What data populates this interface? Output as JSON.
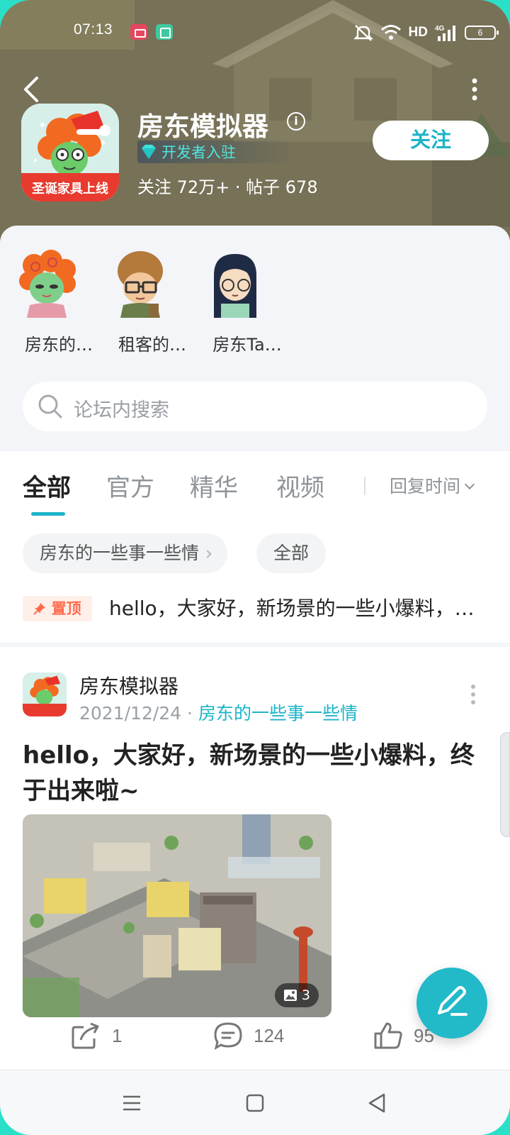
{
  "status_bar": {
    "time": "07:13",
    "network": "HD",
    "signal": "4G",
    "battery": "6"
  },
  "header": {
    "app_name": "房东模拟器",
    "developer_badge": "开发者入驻",
    "stats": "关注 72万+ · 帖子 678",
    "follow_label": "关注",
    "icon_banner_text": "圣诞家具上线"
  },
  "characters": [
    {
      "label": "房东的…"
    },
    {
      "label": "租客的…"
    },
    {
      "label": "房东Ta…"
    }
  ],
  "search": {
    "placeholder": "论坛内搜索"
  },
  "tabs": [
    {
      "label": "全部",
      "active": true
    },
    {
      "label": "官方",
      "active": false
    },
    {
      "label": "精华",
      "active": false
    },
    {
      "label": "视频",
      "active": false
    }
  ],
  "sort": {
    "label": "回复时间"
  },
  "filters": [
    {
      "label": "房东的一些事一些情"
    },
    {
      "label": "全部"
    }
  ],
  "pinned": {
    "badge": "置顶",
    "text": "hello，大家好，新场景的一些小爆料，终于出来啦~"
  },
  "post": {
    "author": "房东模拟器",
    "date": "2021/12/24",
    "separator": "·",
    "category": "房东的一些事一些情",
    "title": "hello，大家好，新场景的一些小爆料，终于出来啦~",
    "image_count": "3",
    "shares": "1",
    "comments": "124",
    "likes": "95"
  },
  "colors": {
    "accent": "#1cb4c8",
    "pin": "#ff6a4d",
    "frame": "#2be0c8"
  },
  "icons": [
    "back-icon",
    "more-icon",
    "info-icon",
    "diamond-icon",
    "search-icon",
    "share-icon",
    "comment-icon",
    "like-icon",
    "edit-icon",
    "menu-icon",
    "home-icon",
    "back-triangle-icon"
  ]
}
